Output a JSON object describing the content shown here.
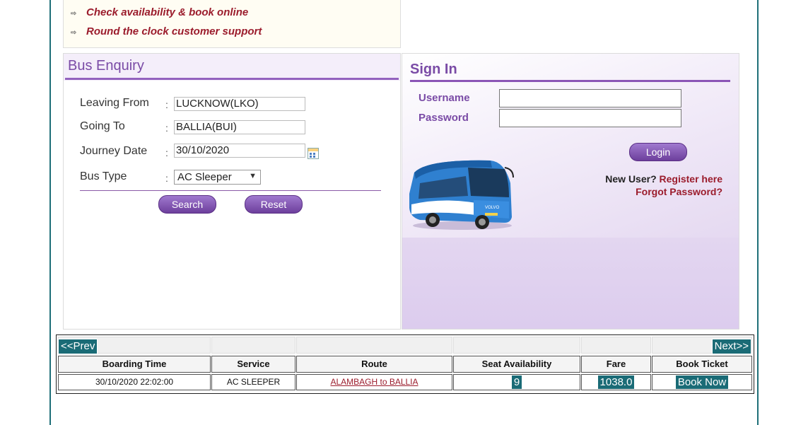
{
  "features": [
    "Check availability & book online",
    "Round the clock customer support"
  ],
  "enquiry": {
    "title": "Bus Enquiry",
    "leaving_from_label": "Leaving From",
    "leaving_from_value": "LUCKNOW(LKO)",
    "going_to_label": "Going To",
    "going_to_value": "BALLIA(BUI)",
    "journey_date_label": "Journey Date",
    "journey_date_value": "30/10/2020",
    "bus_type_label": "Bus Type",
    "bus_type_value": "AC Sleeper",
    "search_label": "Search",
    "reset_label": "Reset"
  },
  "signin": {
    "title": "Sign In",
    "username_label": "Username",
    "password_label": "Password",
    "login_label": "Login",
    "new_user_text": "New User?",
    "register_label": "Register here",
    "forgot_label": "Forgot Password?"
  },
  "results": {
    "prev_label": "<<Prev",
    "next_label": "Next>>",
    "headers": [
      "Boarding Time",
      "Service",
      "Route",
      "Seat Availability",
      "Fare",
      "Book Ticket"
    ],
    "rows": [
      {
        "boarding_time": "30/10/2020 22:02:00",
        "service": "AC SLEEPER",
        "route": "ALAMBAGH to BALLIA",
        "seats": "9",
        "fare": "1038.0",
        "book": "Book Now"
      }
    ]
  }
}
